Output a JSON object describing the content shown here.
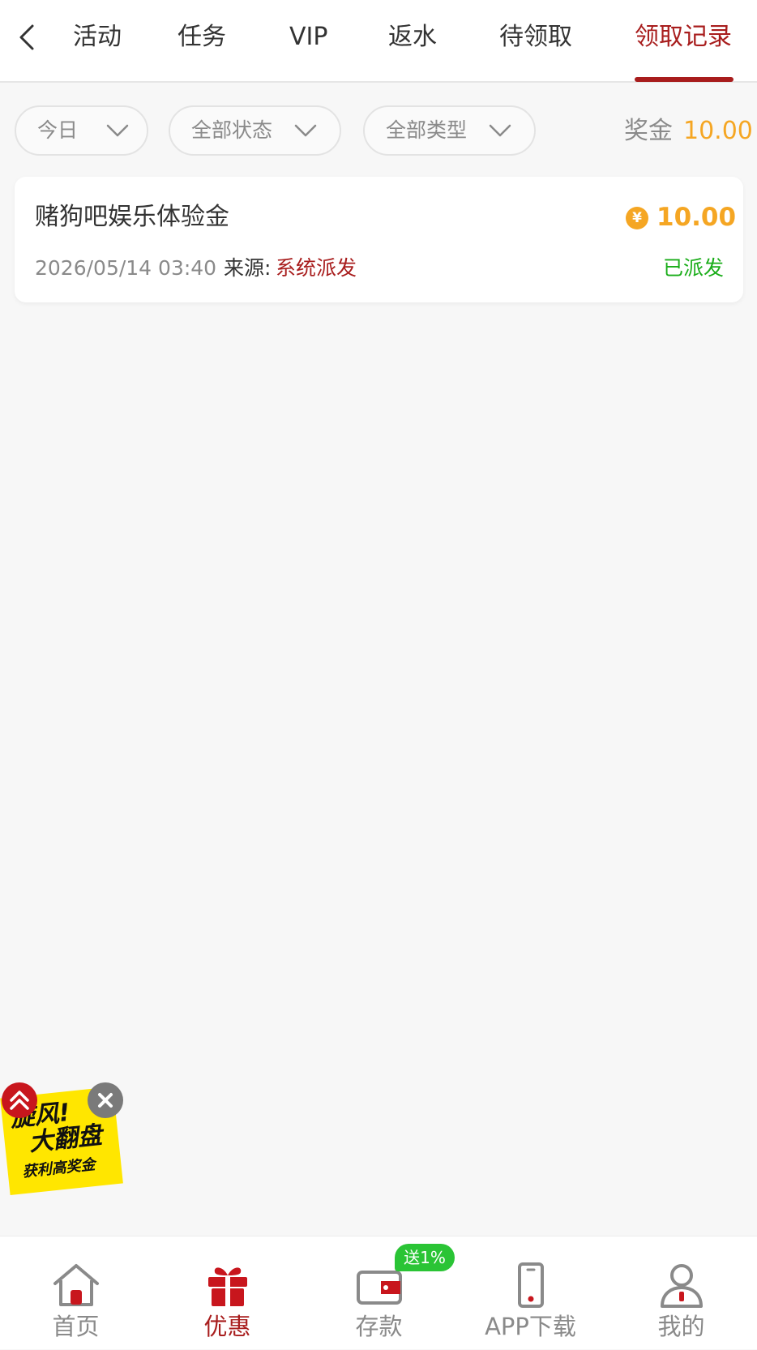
{
  "header": {
    "tabs": [
      {
        "label": "活动",
        "active": false
      },
      {
        "label": "任务",
        "active": false
      },
      {
        "label": "VIP",
        "active": false
      },
      {
        "label": "返水",
        "active": false
      },
      {
        "label": "待领取",
        "active": false
      },
      {
        "label": "领取记录",
        "active": true
      }
    ],
    "back_icon": "chevron-left-icon"
  },
  "filters": {
    "date": "今日",
    "status": "全部状态",
    "type": "全部类型",
    "bonus_label": "奖金",
    "bonus_value": "10.00"
  },
  "records": [
    {
      "title": "赌狗吧娱乐体验金",
      "amount": "10.00",
      "currency_icon": "yuan-coin-icon",
      "coin_glyph": "¥",
      "date": "2026/05/14 03:40",
      "source_label": "来源:",
      "source_value": "系统派发",
      "status": "已派发"
    }
  ],
  "promo": {
    "line1": "旋风!",
    "line2": "大翻盘",
    "line3": "获利高奖金"
  },
  "bottom_nav": {
    "items": [
      {
        "label": "首页",
        "icon": "home-icon",
        "active": false
      },
      {
        "label": "优惠",
        "icon": "gift-icon",
        "active": true
      },
      {
        "label": "存款",
        "icon": "wallet-icon",
        "active": false
      },
      {
        "label": "APP下载",
        "icon": "phone-icon",
        "active": false
      },
      {
        "label": "我的",
        "icon": "user-icon",
        "active": false
      }
    ],
    "deposit_badge": "送1%"
  },
  "colors": {
    "brand_red": "#a81d1d",
    "bonus_orange": "#f5a623",
    "status_green": "#1aad19",
    "background": "#f7f7f7"
  }
}
